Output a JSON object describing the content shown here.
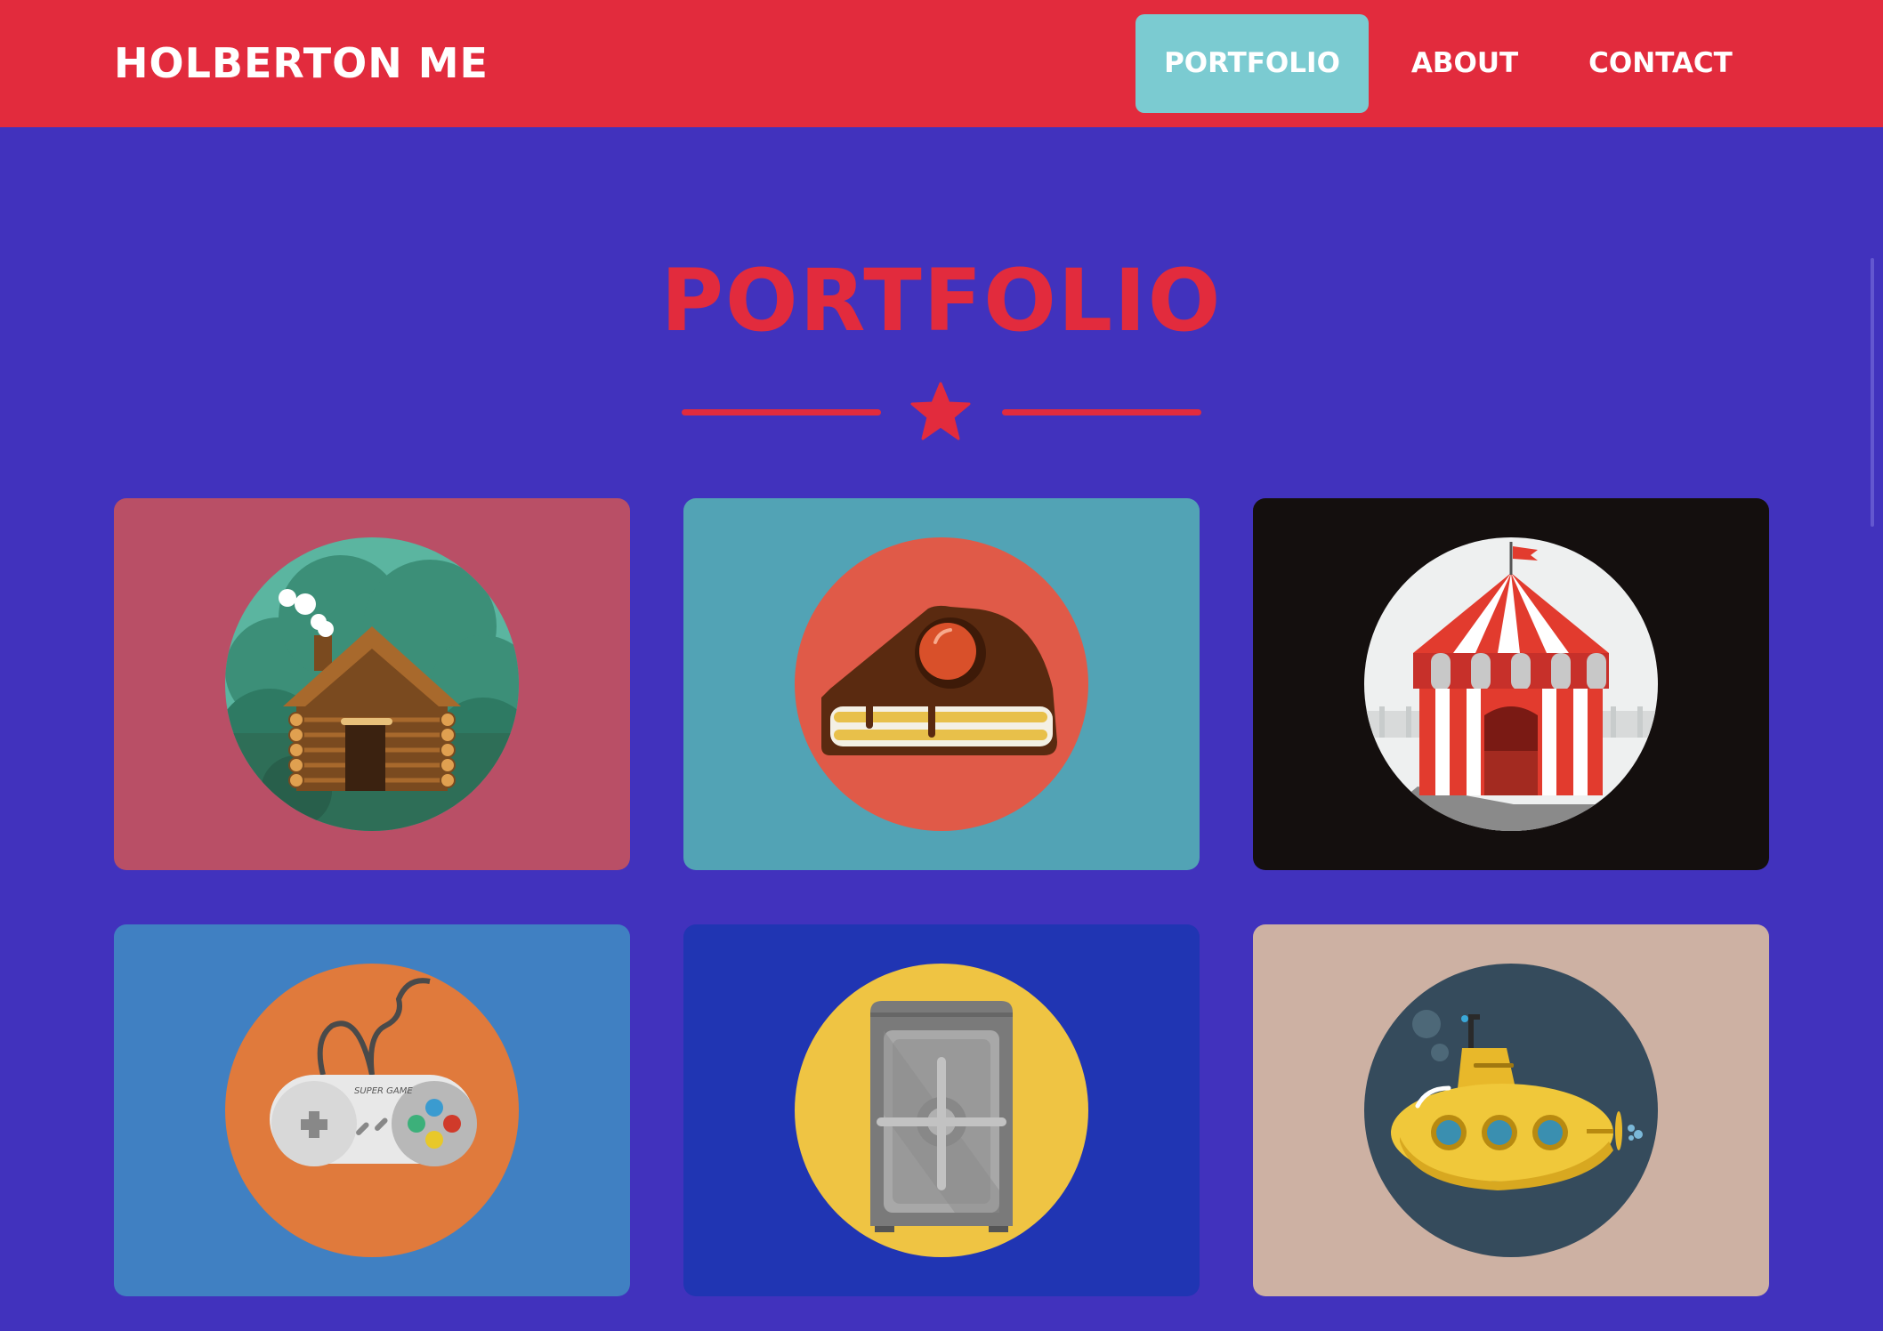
{
  "navbar": {
    "brand": "HOLBERTON ME",
    "items": [
      {
        "label": "PORTFOLIO",
        "active": true
      },
      {
        "label": "ABOUT",
        "active": false
      },
      {
        "label": "CONTACT",
        "active": false
      }
    ],
    "colors": {
      "background": "#e22b3d",
      "active": "#7bcbd1"
    }
  },
  "portfolio": {
    "title": "PORTFOLIO",
    "divider_icon": "star-icon",
    "items": [
      {
        "icon": "log-cabin-icon",
        "background": "#b94f66"
      },
      {
        "icon": "cake-slice-icon",
        "background": "#52a3b5"
      },
      {
        "icon": "circus-tent-icon",
        "background": "#140f0e"
      },
      {
        "icon": "game-controller-icon",
        "background": "#4080c2"
      },
      {
        "icon": "safe-icon",
        "background": "#2035b3"
      },
      {
        "icon": "submarine-icon",
        "background": "#cdb1a3"
      }
    ]
  },
  "controller_text": "SUPER GAME",
  "colors": {
    "page_background": "#4132bd",
    "accent": "#e22b3d"
  }
}
